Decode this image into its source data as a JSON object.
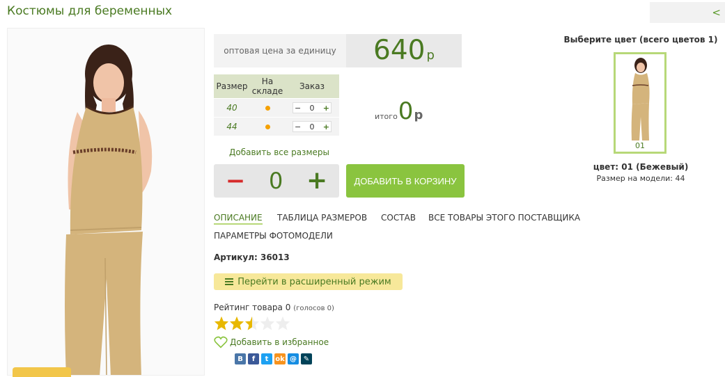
{
  "page": {
    "title": "Костюмы для беременных",
    "back_label": "<"
  },
  "price": {
    "label": "оптовая цена за единицу",
    "value": "640",
    "currency": "р"
  },
  "sizes_table": {
    "headers": [
      "Размер",
      "На складе",
      "Заказ"
    ],
    "rows": [
      {
        "size": "40",
        "qty": "0"
      },
      {
        "size": "44",
        "qty": "0"
      }
    ],
    "minus": "−",
    "plus": "+"
  },
  "total": {
    "label": "итого",
    "value": "0",
    "currency": "р"
  },
  "add_all_label": "Добавить все размеры",
  "quantity": {
    "minus": "−",
    "value": "0",
    "plus": "+"
  },
  "cart_button": "ДОБАВИТЬ В КОРЗИНУ",
  "tabs": [
    {
      "label": "ОПИСАНИЕ",
      "active": true
    },
    {
      "label": "ТАБЛИЦА РАЗМЕРОВ"
    },
    {
      "label": "СОСТАВ"
    },
    {
      "label": "ВСЕ ТОВАРЫ ЭТОГО ПОСТАВЩИКА"
    },
    {
      "label": "ПАРАМЕТРЫ ФОТОМОДЕЛИ"
    }
  ],
  "sku": "Артикул: 36013",
  "extended_mode_button": "Перейти в расширенный режим",
  "rating": {
    "label": "Рейтинг товара 0",
    "votes": "(голосов 0)",
    "stars_filled": 2.5,
    "stars_total": 5
  },
  "favorite_label": "Добавить в избранное",
  "share_icons": [
    {
      "name": "vk",
      "glyph": "B",
      "color": "#4a76a8"
    },
    {
      "name": "facebook",
      "glyph": "f",
      "color": "#3b5998"
    },
    {
      "name": "twitter",
      "glyph": "t",
      "color": "#1da1f2"
    },
    {
      "name": "odnoklassniki",
      "glyph": "ok",
      "color": "#f7931e"
    },
    {
      "name": "mailru",
      "glyph": "@",
      "color": "#168de2"
    },
    {
      "name": "livejournal",
      "glyph": "✎",
      "color": "#004359"
    }
  ],
  "color_picker": {
    "title": "Выберите цвет (всего цветов 1)",
    "swatch_label": "01",
    "color_name": "цвет: 01 (Бежевый)",
    "model_size": "Размер на модели: 44"
  },
  "colors": {
    "accent_green": "#4a7a22",
    "button_green": "#8ac43f",
    "garment_beige": "#d4b47c"
  }
}
